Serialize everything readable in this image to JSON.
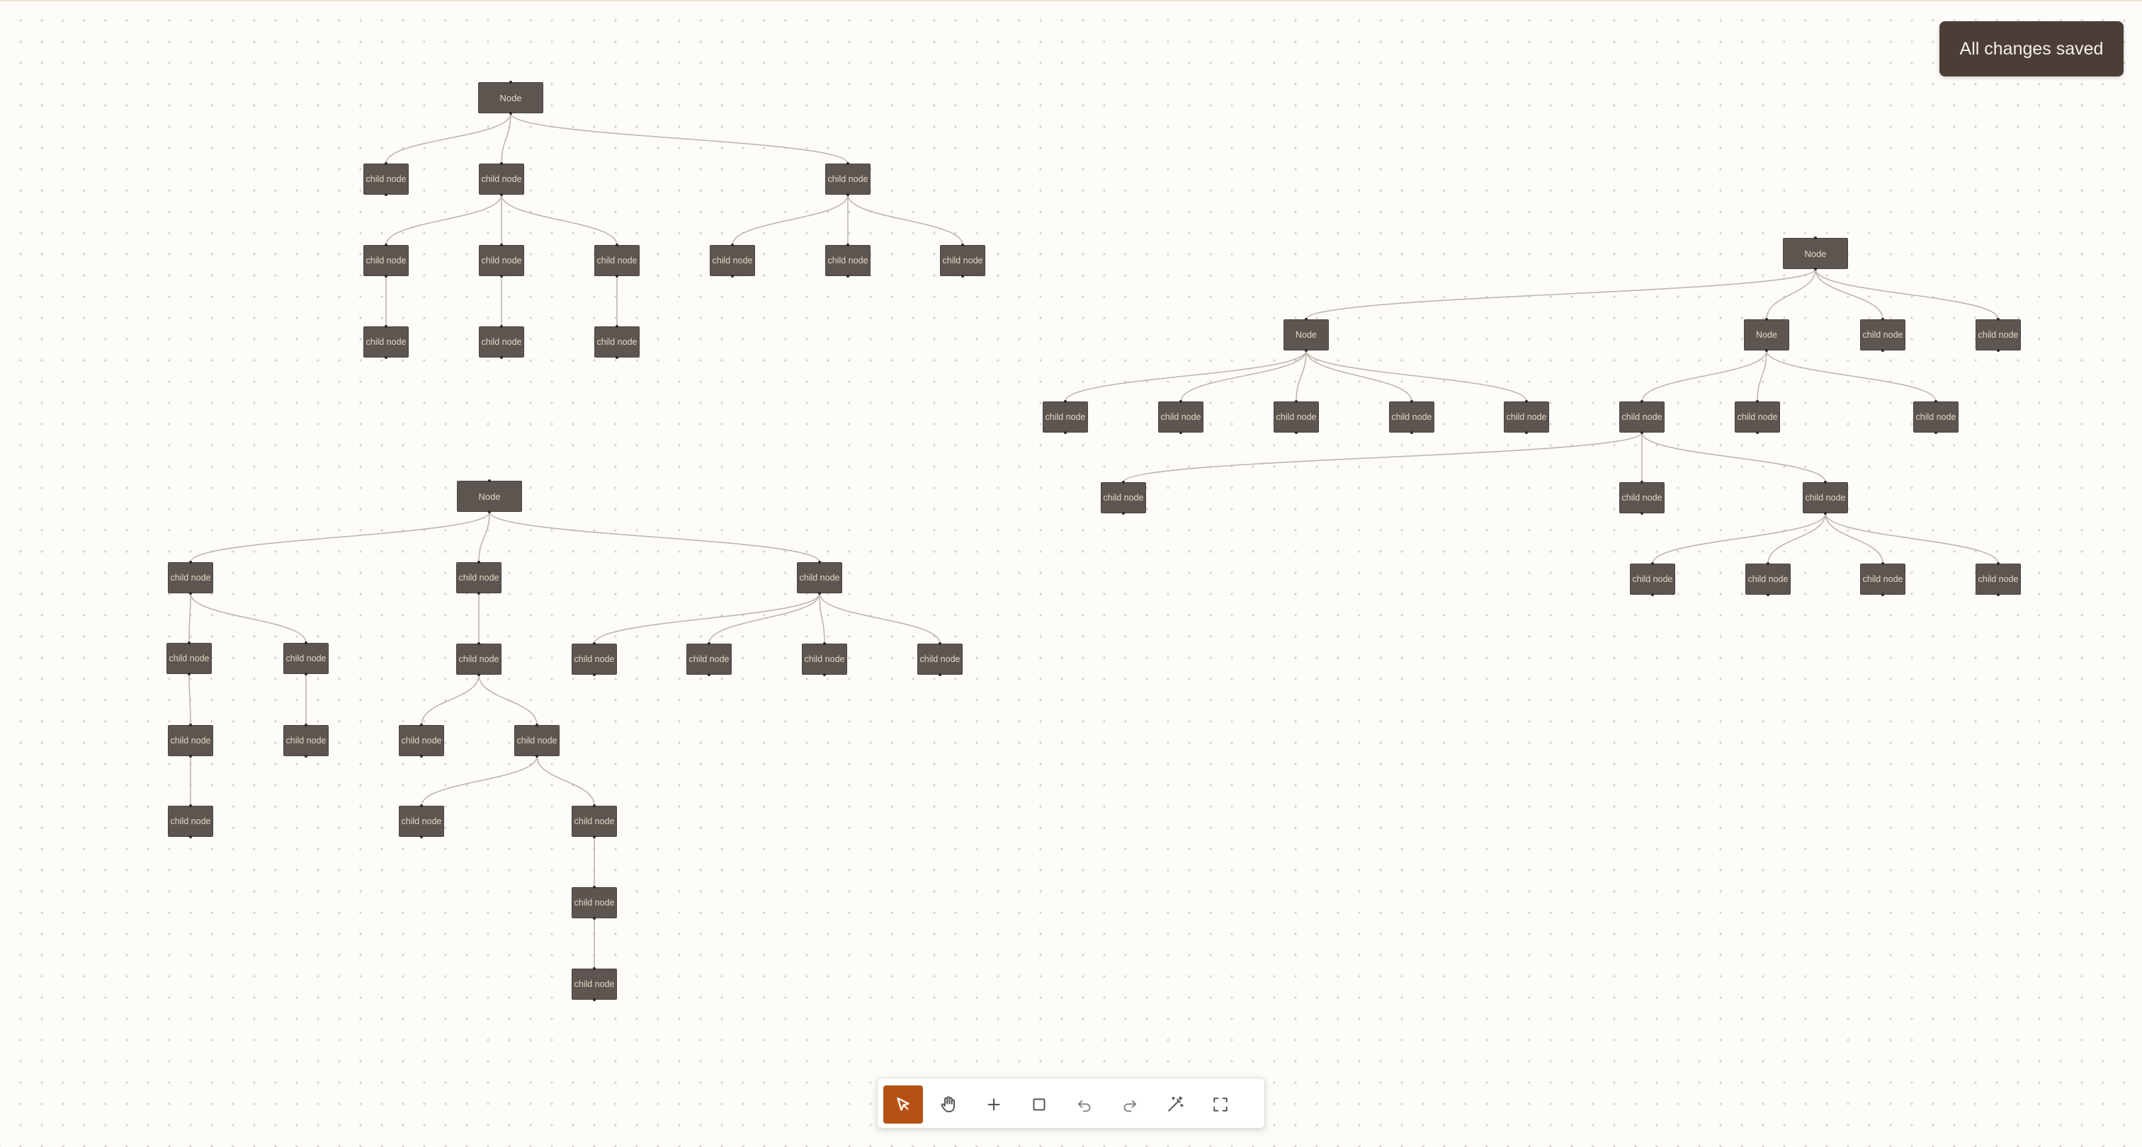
{
  "toast": {
    "message": "All changes saved"
  },
  "toolbar": {
    "active_color": "#b65115",
    "tools": [
      {
        "id": "select",
        "icon": "pointer-arrow-icon",
        "active": true
      },
      {
        "id": "pan",
        "icon": "hand-icon",
        "active": false
      },
      {
        "id": "add-node",
        "icon": "plus-icon",
        "active": false
      },
      {
        "id": "frame",
        "icon": "square-icon",
        "active": false
      },
      {
        "id": "undo",
        "icon": "undo-icon",
        "active": false
      },
      {
        "id": "redo",
        "icon": "redo-icon",
        "active": false
      },
      {
        "id": "auto-layout",
        "icon": "magic-wand-icon",
        "active": false
      },
      {
        "id": "fit-view",
        "icon": "fullscreen-icon",
        "active": false
      }
    ]
  },
  "canvas": {
    "node_color": "#5d5550",
    "node_text_color": "#e3d7c3",
    "edge_color": "#bdb7ad",
    "trees": [
      {
        "label": "Node",
        "children": [
          {
            "label": "child node"
          },
          {
            "label": "child node",
            "children": [
              {
                "label": "child node",
                "children": [
                  {
                    "label": "child node"
                  }
                ]
              },
              {
                "label": "child node",
                "children": [
                  {
                    "label": "child node"
                  }
                ]
              },
              {
                "label": "child node",
                "children": [
                  {
                    "label": "child node"
                  }
                ]
              }
            ]
          },
          {
            "label": "child node",
            "children": [
              {
                "label": "child node"
              },
              {
                "label": "child node"
              },
              {
                "label": "child node"
              }
            ]
          }
        ]
      },
      {
        "label": "Node",
        "children": [
          {
            "label": "child node",
            "children": [
              {
                "label": "child node",
                "children": [
                  {
                    "label": "child node",
                    "children": [
                      {
                        "label": "child node"
                      }
                    ]
                  }
                ]
              },
              {
                "label": "child node",
                "children": [
                  {
                    "label": "child node"
                  }
                ]
              }
            ]
          },
          {
            "label": "child node",
            "children": [
              {
                "label": "child node",
                "children": [
                  {
                    "label": "child node"
                  },
                  {
                    "label": "child node",
                    "children": [
                      {
                        "label": "child node"
                      },
                      {
                        "label": "child node",
                        "children": [
                          {
                            "label": "child node",
                            "children": [
                              {
                                "label": "child node"
                              }
                            ]
                          }
                        ]
                      }
                    ]
                  }
                ]
              }
            ]
          },
          {
            "label": "child node",
            "children": [
              {
                "label": "child node"
              },
              {
                "label": "child node"
              },
              {
                "label": "child node"
              },
              {
                "label": "child node"
              }
            ]
          }
        ]
      },
      {
        "label": "Node",
        "children": [
          {
            "label": "Node",
            "children": [
              {
                "label": "child node"
              },
              {
                "label": "child node"
              },
              {
                "label": "child node"
              },
              {
                "label": "child node"
              },
              {
                "label": "child node"
              }
            ]
          },
          {
            "label": "Node",
            "children": [
              {
                "label": "child node",
                "children": [
                  {
                    "label": "child node"
                  },
                  {
                    "label": "child node"
                  },
                  {
                    "label": "child node",
                    "children": [
                      {
                        "label": "child node"
                      },
                      {
                        "label": "child node"
                      },
                      {
                        "label": "child node"
                      },
                      {
                        "label": "child node"
                      }
                    ]
                  }
                ]
              },
              {
                "label": "child node"
              },
              {
                "label": "child node"
              }
            ]
          },
          {
            "label": "child node"
          },
          {
            "label": "child node"
          }
        ]
      }
    ]
  }
}
